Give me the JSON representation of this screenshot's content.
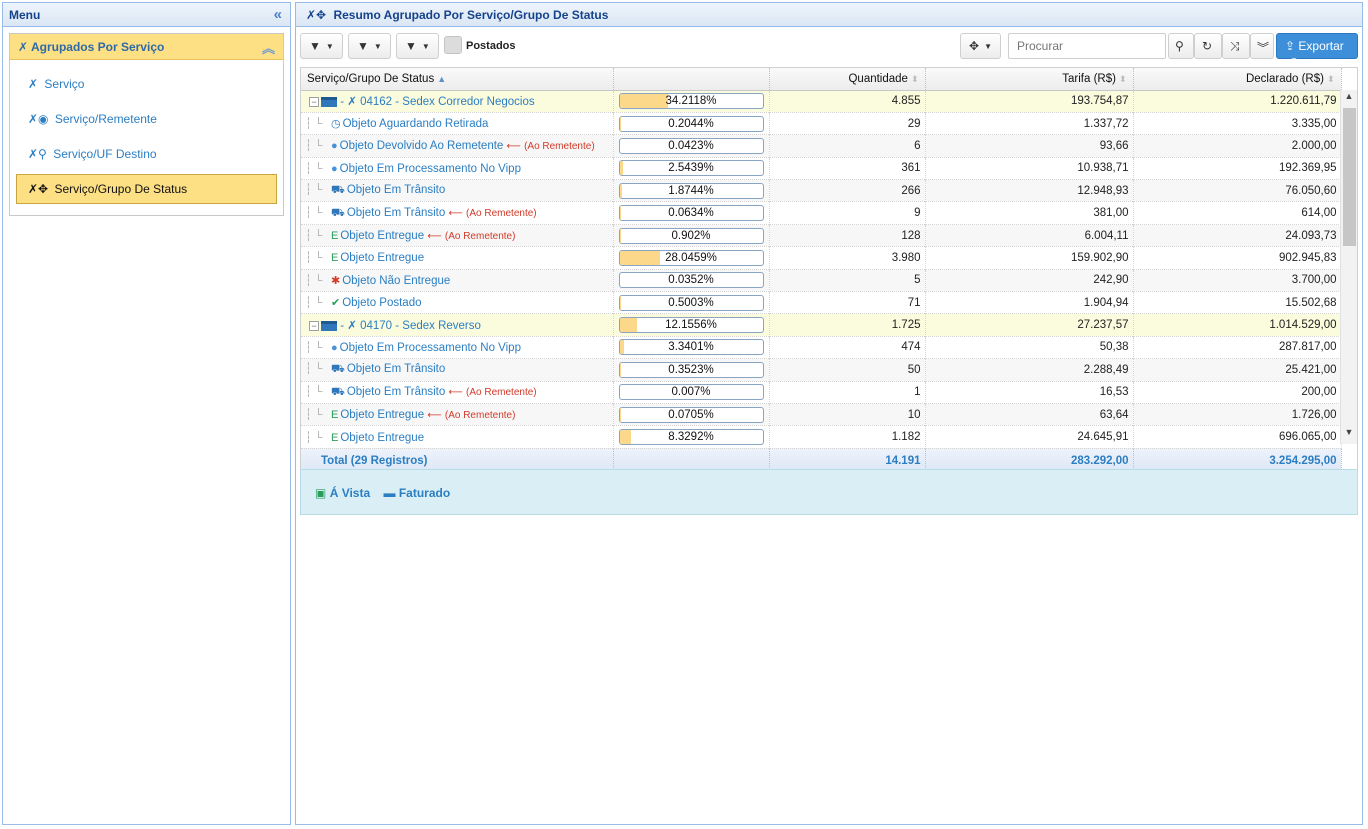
{
  "menu": {
    "title": "Menu",
    "section_title": "Agrupados Por Serviço",
    "items": [
      {
        "label": "Serviço",
        "icon": "service-icon"
      },
      {
        "label": "Serviço/Remetente",
        "icon": "user-circle-icon"
      },
      {
        "label": "Serviço/UF Destino",
        "icon": "map-marker-icon"
      },
      {
        "label": "Serviço/Grupo De Status",
        "icon": "move-icon",
        "active": true
      }
    ]
  },
  "panel": {
    "title": "Resumo Agrupado Por Serviço/Grupo De Status"
  },
  "toolbar": {
    "postados_label": "Postados",
    "search_placeholder": "Procurar",
    "export_label": "Exportar"
  },
  "grid": {
    "columns": [
      "Serviço/Grupo De Status",
      "",
      "Quantidade",
      "Tarifa (R$)",
      "Declarado (R$)"
    ],
    "rows": [
      {
        "type": "group",
        "label": "04162 - Sedex Corredor Negocios",
        "pct": "34.2118%",
        "pct_value": 34.2118,
        "qtd": "4.855",
        "tarifa": "193.754,87",
        "declarado": "1.220.611,79"
      },
      {
        "type": "item",
        "icon": "clock-icon",
        "label": "Objeto Aguardando Retirada",
        "pct": "0.2044%",
        "pct_value": 0.2044,
        "qtd": "29",
        "tarifa": "1.337,72",
        "declarado": "3.335,00"
      },
      {
        "type": "item",
        "icon": "globe-icon",
        "label": "Objeto Devolvido Ao Remetente",
        "warn": "(Ao Remetente)",
        "pct": "0.0423%",
        "pct_value": 0.0423,
        "qtd": "6",
        "tarifa": "93,66",
        "declarado": "2.000,00"
      },
      {
        "type": "item",
        "icon": "globe-icon",
        "label": "Objeto Em Processamento No Vipp",
        "pct": "2.5439%",
        "pct_value": 2.5439,
        "qtd": "361",
        "tarifa": "10.938,71",
        "declarado": "192.369,95"
      },
      {
        "type": "item",
        "icon": "truck-icon",
        "label": "Objeto Em Trânsito",
        "pct": "1.8744%",
        "pct_value": 1.8744,
        "qtd": "266",
        "tarifa": "12.948,93",
        "declarado": "76.050,60"
      },
      {
        "type": "item",
        "icon": "truck-icon",
        "label": "Objeto Em Trânsito",
        "warn": "(Ao Remetente)",
        "pct": "0.0634%",
        "pct_value": 0.0634,
        "qtd": "9",
        "tarifa": "381,00",
        "declarado": "614,00"
      },
      {
        "type": "item",
        "icon": "letter-e-icon",
        "label": "Objeto Entregue",
        "warn": "(Ao Remetente)",
        "pct": "0.902%",
        "pct_value": 0.902,
        "qtd": "128",
        "tarifa": "6.004,11",
        "declarado": "24.093,73"
      },
      {
        "type": "item",
        "icon": "letter-e-icon",
        "label": "Objeto Entregue",
        "pct": "28.0459%",
        "pct_value": 28.0459,
        "qtd": "3.980",
        "tarifa": "159.902,90",
        "declarado": "902.945,83"
      },
      {
        "type": "item",
        "icon": "bug-icon",
        "label": "Objeto Não Entregue",
        "pct": "0.0352%",
        "pct_value": 0.0352,
        "qtd": "5",
        "tarifa": "242,90",
        "declarado": "3.700,00"
      },
      {
        "type": "item",
        "icon": "check-icon",
        "label": "Objeto Postado",
        "pct": "0.5003%",
        "pct_value": 0.5003,
        "qtd": "71",
        "tarifa": "1.904,94",
        "declarado": "15.502,68"
      },
      {
        "type": "group",
        "label": "04170 - Sedex Reverso",
        "pct": "12.1556%",
        "pct_value": 12.1556,
        "qtd": "1.725",
        "tarifa": "27.237,57",
        "declarado": "1.014.529,00"
      },
      {
        "type": "item",
        "icon": "globe-icon",
        "label": "Objeto Em Processamento No Vipp",
        "pct": "3.3401%",
        "pct_value": 3.3401,
        "qtd": "474",
        "tarifa": "50,38",
        "declarado": "287.817,00"
      },
      {
        "type": "item",
        "icon": "truck-icon",
        "label": "Objeto Em Trânsito",
        "pct": "0.3523%",
        "pct_value": 0.3523,
        "qtd": "50",
        "tarifa": "2.288,49",
        "declarado": "25.421,00"
      },
      {
        "type": "item",
        "icon": "truck-icon",
        "label": "Objeto Em Trânsito",
        "warn": "(Ao Remetente)",
        "pct": "0.007%",
        "pct_value": 0.007,
        "qtd": "1",
        "tarifa": "16,53",
        "declarado": "200,00"
      },
      {
        "type": "item",
        "icon": "letter-e-icon",
        "label": "Objeto Entregue",
        "warn": "(Ao Remetente)",
        "pct": "0.0705%",
        "pct_value": 0.0705,
        "qtd": "10",
        "tarifa": "63,64",
        "declarado": "1.726,00"
      },
      {
        "type": "item",
        "icon": "letter-e-icon",
        "label": "Objeto Entregue",
        "pct": "8.3292%",
        "pct_value": 8.3292,
        "qtd": "1.182",
        "tarifa": "24.645,91",
        "declarado": "696.065,00"
      }
    ],
    "footer": {
      "label": "Total (29 Registros)",
      "qtd": "14.191",
      "tarifa": "283.292,00",
      "declarado": "3.254.295,00"
    }
  },
  "payment": {
    "a_vista": "Á Vista",
    "faturado": "Faturado"
  },
  "colors": {
    "accent": "#2b7ec2",
    "active_item": "#fddf84",
    "group_row": "#fbfbdd",
    "bar_fill": "#fcd98a",
    "warn": "#d23a2a",
    "export_btn": "#3c8fd8"
  }
}
